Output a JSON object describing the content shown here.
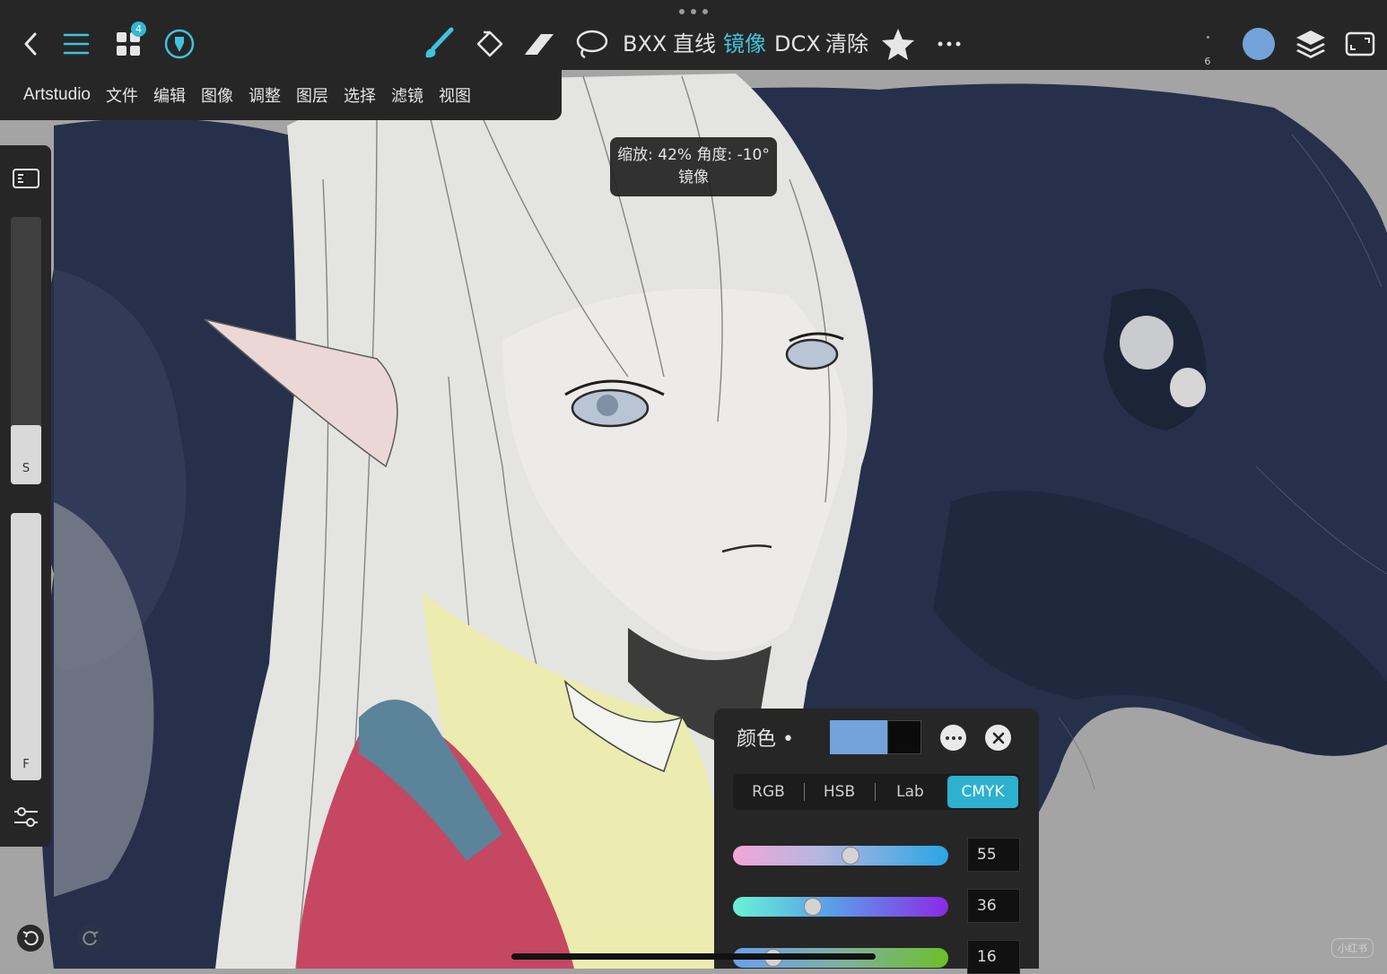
{
  "app": "Artstudio",
  "toolbar": {
    "actions": [
      "BXX",
      "直线",
      "镜像",
      "DCX",
      "清除"
    ],
    "active_action": "镜像",
    "notification_count": "4",
    "brush_size": "6",
    "current_color": "#74a2da",
    "icons": [
      "back-icon",
      "menu-icon",
      "apps-icon",
      "pen-settings-icon",
      "brush-icon",
      "fill-icon",
      "eraser-icon",
      "lasso-icon",
      "star-icon",
      "more-icon",
      "layers-icon",
      "fullscreen-icon"
    ]
  },
  "menu": {
    "items": [
      "Artstudio",
      "文件",
      "编辑",
      "图像",
      "调整",
      "图层",
      "选择",
      "滤镜",
      "视图"
    ]
  },
  "zoom_tooltip": {
    "line1": "缩放: 42% 角度: -10°",
    "line2": "镜像"
  },
  "sidebar": {
    "size_label": "S",
    "size_value": 0.22,
    "flow_label": "F",
    "flow_value": 1.0
  },
  "color_panel": {
    "title": "颜色 •",
    "primary_color": "#74a2da",
    "secondary_color": "#0b0b0b",
    "tabs": [
      "RGB",
      "HSB",
      "Lab",
      "CMYK"
    ],
    "active_tab": "CMYK",
    "sliders": [
      {
        "channel": "C",
        "value": "55",
        "fraction": 0.55
      },
      {
        "channel": "M",
        "value": "36",
        "fraction": 0.36
      },
      {
        "channel": "Y",
        "value": "16",
        "fraction": 0.16
      }
    ]
  },
  "accent_color": "#3fc3de",
  "watermark": "小红书"
}
